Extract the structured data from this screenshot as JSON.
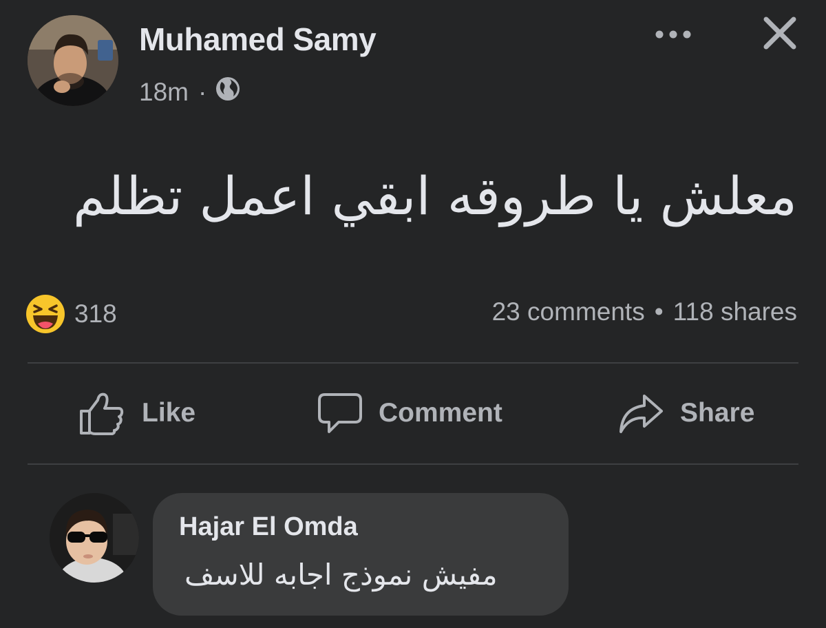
{
  "post": {
    "author": "Muhamed Samy",
    "time": "18m",
    "separator": "·",
    "audience_icon": "globe-icon",
    "text": "معلش يا طروقه ابقي اعمل تظلم"
  },
  "reactions": {
    "icon": "haha-icon",
    "count": "318",
    "comments": "23 comments",
    "separator": "•",
    "shares": "118 shares"
  },
  "actions": {
    "like": "Like",
    "comment": "Comment",
    "share": "Share"
  },
  "comment": {
    "author": "Hajar El Omda",
    "text": "مفيش نموذج اجابه للاسف"
  },
  "colors": {
    "background": "#242526",
    "text_primary": "#e4e6eb",
    "text_secondary": "#b0b3b8",
    "bubble": "#3a3b3c",
    "divider": "#3e4042",
    "haha": "#f7c52b"
  }
}
